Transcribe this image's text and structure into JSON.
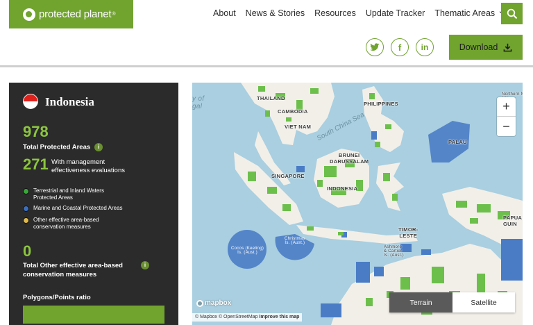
{
  "header": {
    "logo_text": "protected planet",
    "logo_mark": "®",
    "nav": [
      "About",
      "News & Stories",
      "Resources",
      "Update Tracker",
      "Thematic Areas"
    ],
    "download_label": "Download",
    "icons": [
      "search-icon",
      "twitter-icon",
      "facebook-icon",
      "linkedin-icon",
      "download-icon"
    ],
    "social": {
      "twitter": "t",
      "facebook": "f",
      "linkedin": "in"
    }
  },
  "sidebar": {
    "country": "Indonesia",
    "total_pa": "978",
    "total_pa_label": "Total Protected Areas",
    "mgmt_count": "271",
    "mgmt_label": "With management effectiveness evaluations",
    "legend": [
      {
        "label": "Terrestrial and Inland Waters Protected Areas",
        "color": "#38a83a"
      },
      {
        "label": "Marine and Coastal Protected Areas",
        "color": "#3a6fc0"
      },
      {
        "label": "Other effective area-based conservation measures",
        "color": "#e0b94a"
      }
    ],
    "oecm_count": "0",
    "oecm_label": "Total Other effective area-based conservation measures",
    "ratio_label": "Polygons/Points ratio",
    "info": "i"
  },
  "map": {
    "labels": {
      "thailand": "THAILAND",
      "cambodia": "CAMBODIA",
      "vietnam": "VIET NAM",
      "philippines": "PHILIPPINES",
      "brunei": "BRUNEI\nDARUSSALAM",
      "singapore": "SINGAPORE",
      "indonesia": "INDONESIA",
      "palau": "PALAU",
      "timor": "TIMOR-\nLESTE",
      "papua": "PAPUA\nGUIN",
      "ashmore": "Ashmore\n& Cartier\nIs. (Aust.)",
      "cocos": "Cocos (Keeling)\nIs. (Aust.)",
      "christmas": "Christmas\nIs. (Aust.)",
      "northern": "Northern M\nIsla",
      "sea": "South China Sea",
      "bengal": "y of\ngal"
    },
    "zoom_in": "+",
    "zoom_out": "−",
    "terrain": "Terrain",
    "satellite": "Satellite",
    "mapbox": "mapbox",
    "attribution_prefix": "© Mapbox © OpenStreetMap",
    "attribution_link": "Improve this map"
  }
}
